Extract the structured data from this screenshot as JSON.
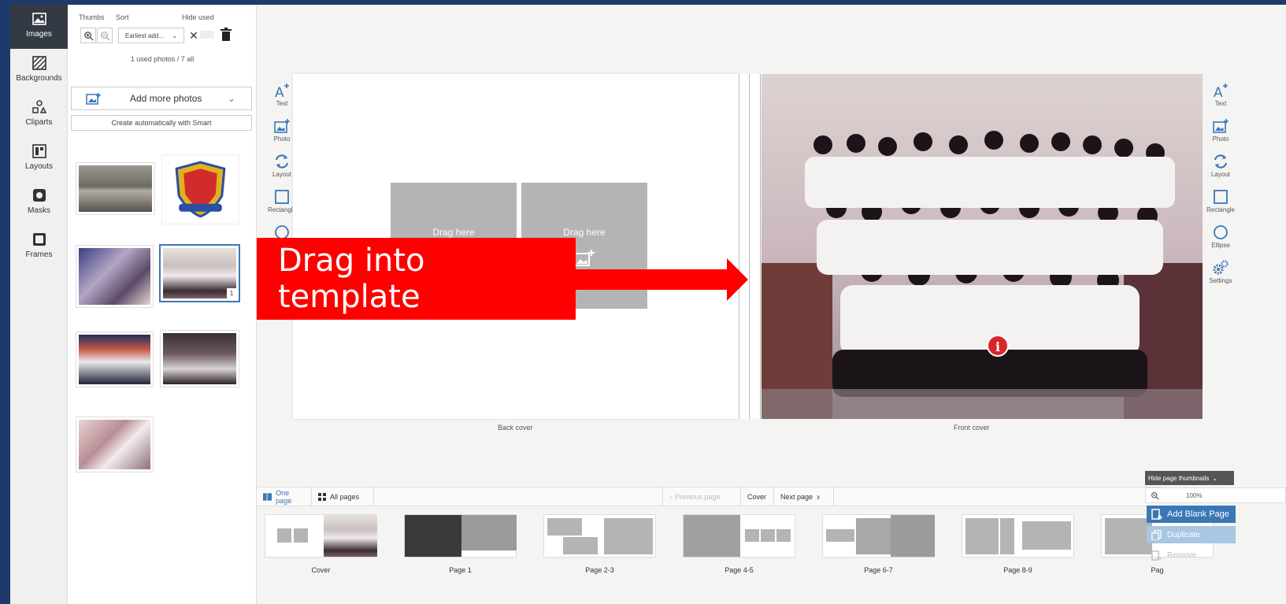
{
  "nav": {
    "items": [
      {
        "label": "Images",
        "icon": "image-icon"
      },
      {
        "label": "Backgrounds",
        "icon": "background-icon"
      },
      {
        "label": "Cliparts",
        "icon": "shapes-icon"
      },
      {
        "label": "Layouts",
        "icon": "layout-icon"
      },
      {
        "label": "Masks",
        "icon": "mask-icon"
      },
      {
        "label": "Frames",
        "icon": "frame-icon"
      }
    ]
  },
  "panel": {
    "thumbs_label": "Thumbs",
    "sort_label": "Sort",
    "sort_value": "Earliest add...",
    "hide_used_label": "Hide used",
    "count_text": "1 used photos / 7 all",
    "add_more_label": "Add more photos",
    "smart_label": "Create automatically with Smart",
    "used_badge": "1"
  },
  "tools": [
    {
      "label": "Text",
      "icon": "text-add-icon"
    },
    {
      "label": "Photo",
      "icon": "photo-add-icon"
    },
    {
      "label": "Layout",
      "icon": "layout-cycle-icon"
    },
    {
      "label": "Rectangle",
      "icon": "rectangle-icon"
    },
    {
      "label": "Ellipse",
      "icon": "ellipse-icon"
    }
  ],
  "settings_label": "Settings",
  "canvas": {
    "slot_label": "Drag here",
    "back_cover_label": "Back cover",
    "front_cover_label": "Front cover",
    "callout_text": "Drag into template",
    "info_badge": "i"
  },
  "pagebar": {
    "one_page": "One page",
    "all_pages": "All pages",
    "previous": "Previous page",
    "current": "Cover",
    "next": "Next page"
  },
  "page_thumbs": [
    "Cover",
    "Page 1",
    "Page 2-3",
    "Page 4-5",
    "Page 6-7",
    "Page 8-9",
    "Pag"
  ],
  "right": {
    "hide_thumbs": "Hide page thumbnails",
    "zoom": "100%",
    "add_blank": "Add Blank Page",
    "duplicate": "Duplicate",
    "remove": "Remove"
  },
  "colors": {
    "accent": "#3a78b5",
    "callout": "#ff0000",
    "frame": "#1e3a6b"
  }
}
